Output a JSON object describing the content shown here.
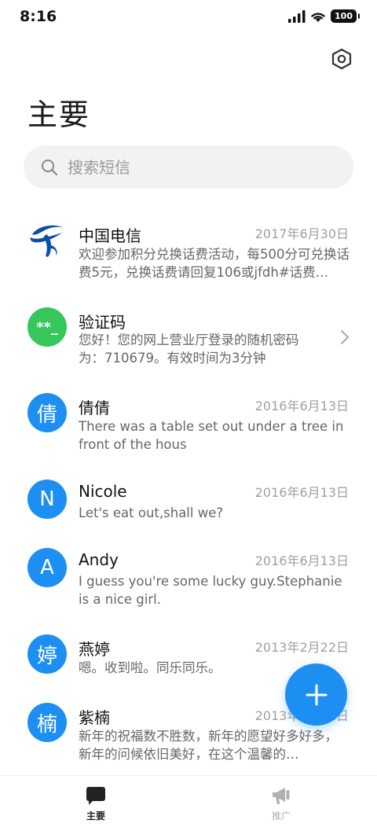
{
  "status_bar": {
    "time": "8:16",
    "battery": "100"
  },
  "header": {
    "title": "主要"
  },
  "search": {
    "placeholder": "搜索短信"
  },
  "messages": [
    {
      "sender": "中国电信",
      "date": "2017年6月30日",
      "preview": "欢迎参加积分兑换话费活动，每500分可兑换话费5元，兑换话费请回复106或jfdh#话费…",
      "avatar_text": "",
      "avatar_color": "#ffffff"
    },
    {
      "sender": "验证码",
      "date": "",
      "preview": "您好！您的网上营业厅登录的随机密码为：710679。有效时间为3分钟",
      "avatar_text": "**_",
      "avatar_color": "#35c759"
    },
    {
      "sender": "倩倩",
      "date": "2016年6月13日",
      "preview": "There was a table set out under a tree in front of the hous",
      "avatar_text": "倩",
      "avatar_color": "#1d8ff2"
    },
    {
      "sender": "Nicole",
      "date": "2016年6月13日",
      "preview": "Let's eat out,shall we?",
      "avatar_text": "N",
      "avatar_color": "#1d8ff2"
    },
    {
      "sender": "Andy",
      "date": "2016年6月13日",
      "preview": "I guess you're some lucky guy.Stephanie is a nice girl.",
      "avatar_text": "A",
      "avatar_color": "#1d8ff2"
    },
    {
      "sender": "燕婷",
      "date": "2013年2月22日",
      "preview": "嗯。收到啦。同乐同乐。",
      "avatar_text": "婷",
      "avatar_color": "#1d8ff2"
    },
    {
      "sender": "紫楠",
      "date": "2013年2月22日",
      "preview": "新年的祝福数不胜数，新年的愿望好多好多，新年的问候依旧美好，在这个温馨的…",
      "avatar_text": "楠",
      "avatar_color": "#1d8ff2"
    }
  ],
  "bottom_nav": {
    "primary": {
      "label": "主要",
      "color": "#222222"
    },
    "promo": {
      "label": "推广",
      "color": "#b0b0b0"
    }
  },
  "colors": {
    "accent": "#1d8ff2"
  }
}
